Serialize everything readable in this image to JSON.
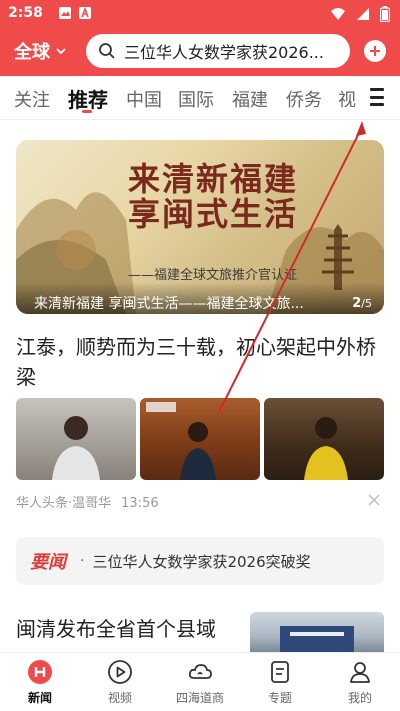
{
  "status_bar": {
    "time": "2:58"
  },
  "header": {
    "region_label": "全球",
    "search_text": "三位华人女数学家获2026..."
  },
  "tabs": [
    {
      "label": "关注"
    },
    {
      "label": "推荐",
      "active": true
    },
    {
      "label": "中国"
    },
    {
      "label": "国际"
    },
    {
      "label": "福建"
    },
    {
      "label": "侨务"
    },
    {
      "label": "视"
    }
  ],
  "banner": {
    "title": "来清新福建 享闽式生活",
    "subtitle": "——福建全球文旅推介官认证",
    "caption": "来清新福建 享闽式生活——福建全球文旅...",
    "page_current": "2",
    "page_total": "/5"
  },
  "article1": {
    "title": "江泰，顺势而为三十载，初心架起中外桥梁",
    "source": "华人头条·温哥华",
    "time": "13:56"
  },
  "headline_strip": {
    "tag": "要闻",
    "dot": "·",
    "text": "三位华人女数学家获2026突破奖"
  },
  "article2": {
    "title": "闽清发布全省首个县域"
  },
  "bottom_nav": [
    {
      "label": "新闻",
      "icon": "news-icon",
      "active": true
    },
    {
      "label": "视频",
      "icon": "play-icon"
    },
    {
      "label": "四海道商",
      "icon": "cloud-icon"
    },
    {
      "label": "专题",
      "icon": "document-icon"
    },
    {
      "label": "我的",
      "icon": "person-icon"
    }
  ],
  "colors": {
    "brand_red": "#ef4b4b",
    "accent_red": "#e03d3d"
  }
}
